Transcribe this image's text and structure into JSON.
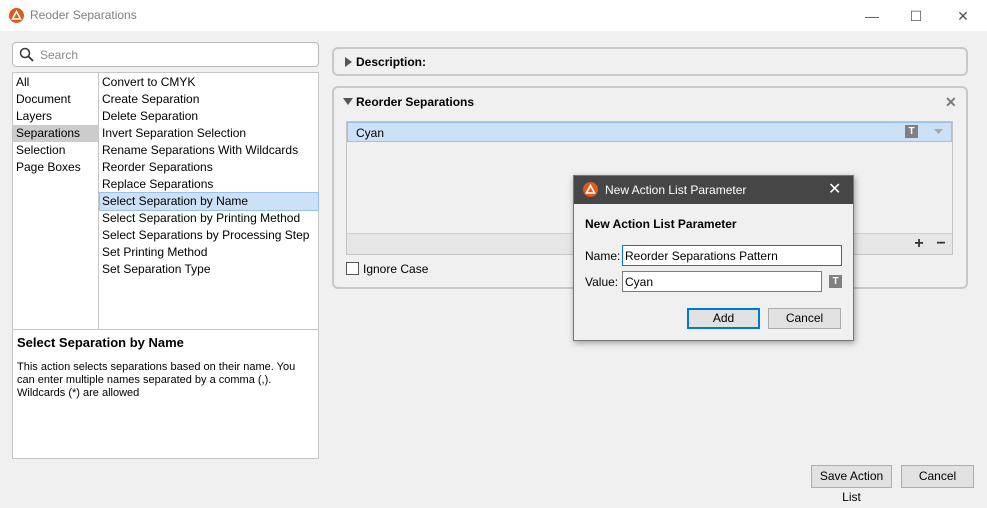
{
  "window": {
    "title": "Reoder Separations",
    "minimize_glyph": "—",
    "maximize_glyph": "☐",
    "close_glyph": "✕"
  },
  "search": {
    "placeholder": "Search",
    "value": ""
  },
  "categories": [
    {
      "label": "All"
    },
    {
      "label": "Document"
    },
    {
      "label": "Layers"
    },
    {
      "label": "Separations",
      "selected": true
    },
    {
      "label": "Selection"
    },
    {
      "label": "Page Boxes"
    }
  ],
  "actions": [
    {
      "label": "Convert to CMYK"
    },
    {
      "label": "Create Separation"
    },
    {
      "label": "Delete Separation"
    },
    {
      "label": "Invert Separation Selection"
    },
    {
      "label": "Rename Separations With Wildcards"
    },
    {
      "label": "Reorder Separations"
    },
    {
      "label": "Replace Separations"
    },
    {
      "label": "Select Separation by Name",
      "selected": true
    },
    {
      "label": "Select Separation by Printing Method"
    },
    {
      "label": "Select Separations by Processing Step"
    },
    {
      "label": "Set Printing Method"
    },
    {
      "label": "Set Separation Type"
    }
  ],
  "description_box": {
    "title": "Select Separation by Name",
    "text": "This action selects separations based on their name. You can enter multiple names separated by a comma (,). Wildcards (*) are allowed"
  },
  "description_section": {
    "label": "Description:"
  },
  "reorder_section": {
    "title": "Reorder Separations",
    "close_glyph": "✕",
    "items": [
      {
        "label": "Cyan",
        "type_icon": "T"
      }
    ],
    "add_glyph": "+",
    "remove_glyph": "−",
    "ignore_case_label": "Ignore Case",
    "ignore_case_checked": false
  },
  "dialog": {
    "title": "New Action List Parameter",
    "heading": "New Action List Parameter",
    "close_glyph": "✕",
    "name_label": "Name:",
    "name_value": "Reorder Separations Pattern",
    "value_label": "Value:",
    "value_value": "Cyan",
    "type_icon": "T",
    "add_label": "Add",
    "cancel_label": "Cancel"
  },
  "footer": {
    "save_label": "Save Action List",
    "cancel_label": "Cancel"
  },
  "colors": {
    "accent": "#e05a1a",
    "selection_blue": "#cce0f7",
    "dialog_titlebar": "#464646",
    "focus_border": "#0078d7"
  },
  "icons": {
    "app": "app-logo-icon",
    "search": "search-icon",
    "expand": "triangle-right-icon",
    "collapse": "triangle-down-icon",
    "text_type": "text-type-icon"
  }
}
